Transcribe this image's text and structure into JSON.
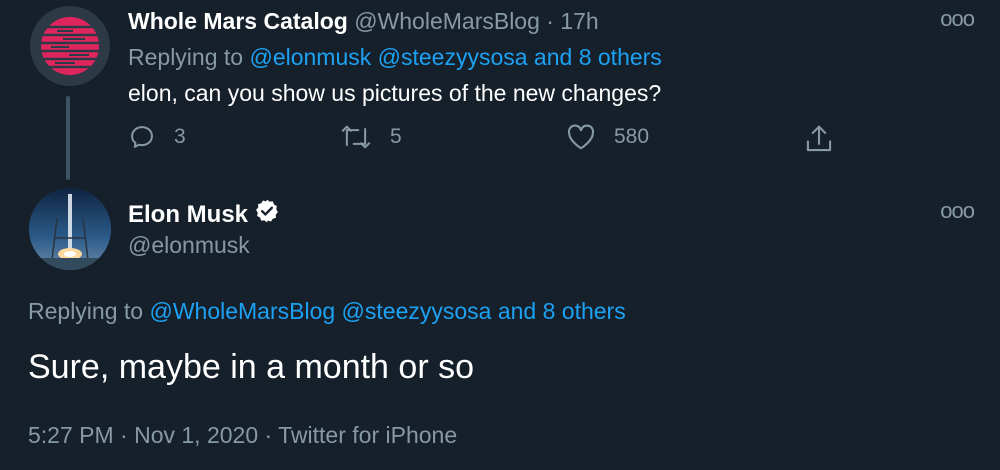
{
  "tweet1": {
    "display_name": "Whole Mars Catalog",
    "handle": "@WholeMarsBlog",
    "separator": "·",
    "time": "17h",
    "replying_prefix": "Replying to",
    "replying_mentions": "@elonmusk @steezyysosa and 8 others",
    "text": "elon, can you show us pictures of the new changes?",
    "reply_count": "3",
    "retweet_count": "5",
    "like_count": "580",
    "more_label": "ooo"
  },
  "tweet2": {
    "display_name": "Elon Musk",
    "handle": "@elonmusk",
    "replying_prefix": "Replying to",
    "replying_mentions": "@WholeMarsBlog @steezyysosa and 8 others",
    "text": "Sure, maybe in a month or so",
    "meta": "5:27 PM · Nov 1, 2020 · Twitter for iPhone",
    "more_label": "ooo"
  },
  "colors": {
    "background": "#15202b",
    "muted": "#8899a6",
    "link": "#1da1f2",
    "avatar_accent": "#e0245e"
  },
  "icons": {
    "reply": "reply-icon",
    "retweet": "retweet-icon",
    "like": "like-icon",
    "share": "share-icon",
    "more": "more-icon",
    "verified": "verified-badge-icon"
  }
}
